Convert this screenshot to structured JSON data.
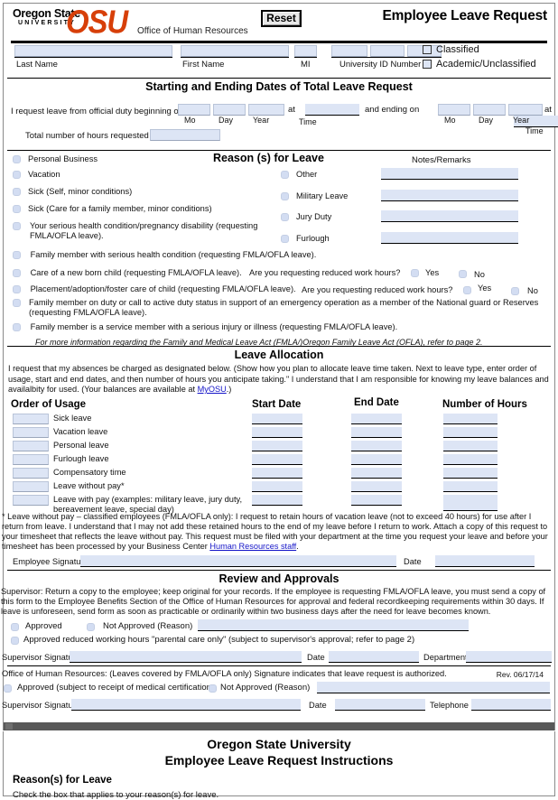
{
  "header": {
    "logo_line1": "Oregon State",
    "logo_line2": "UNIVERSITY",
    "logo_mark": "OSU",
    "office": "Office of Human Resources",
    "reset_label": "Reset",
    "title": "Employee Leave Request",
    "brand_color": "#D73F09"
  },
  "identity": {
    "last_name_label": "Last Name",
    "first_name_label": "First Name",
    "mi_label": "MI",
    "id_label": "University ID Number",
    "last_name_value": "",
    "first_name_value": "",
    "mi_value": "",
    "id_value": "",
    "classified_label": "Classified",
    "academic_label": "Academic/Unclassified"
  },
  "dates": {
    "section_title": "Starting and Ending Dates of Total Leave Request",
    "lead_text": "I request leave from official duty beginning on",
    "at_1": "at",
    "and_ending": "and ending on",
    "at_2": "at",
    "mo_label": "Mo",
    "day_label": "Day",
    "year_label": "Year",
    "time_label": "Time",
    "total_hours_label": "Total number of hours requested",
    "begin_mo": "",
    "begin_day": "",
    "begin_year": "",
    "begin_time": "",
    "end_mo": "",
    "end_day": "",
    "end_year": "",
    "end_time": "",
    "total_hours_value": ""
  },
  "reasons": {
    "section_title": "Reason (s) for Leave",
    "notes_title": "Notes/Remarks",
    "left_items": [
      "Personal Business",
      "Vacation",
      "Sick (Self, minor conditions)",
      "Sick (Care for a family member, minor conditions)",
      "Your serious health condition/pregnancy disability (requesting FMLA/OFLA leave)."
    ],
    "right_items": [
      {
        "label": "Other",
        "note": ""
      },
      {
        "label": "Military Leave",
        "note": ""
      },
      {
        "label": "Jury Duty",
        "note": ""
      },
      {
        "label": "Furlough",
        "note": ""
      }
    ],
    "wide_items": [
      "Family member with serious health condition (requesting FMLA/OFLA leave).",
      "Care of a new born child (requesting FMLA/OFLA leave).",
      "Placement/adoption/foster care of child (requesting FMLA/OFLA leave).",
      "Family member on duty or call to active duty status in support of an emergency operation as a member of the National guard or Reserves (requesting FMLA/OFLA leave).",
      "Family member is a service member with a serious injury or illness (requesting FMLA/OFLA leave)."
    ],
    "reduced_hours_question": "Are you requesting reduced work hours?",
    "yes_label": "Yes",
    "no_label": "No",
    "fmla_note": "For more information regarding the Family and Medical Leave Act (FMLA/)Oregon Family Leave Act (OFLA), refer to page 2."
  },
  "allocation": {
    "section_title": "Leave Allocation",
    "intro": "I request that my absences be charged as designated below.  (Show how you plan to allocate leave time taken.  Next to leave type, enter order of usage, start and end dates, and then number of hours you anticipate taking.\"  I understand that I am responsible for knowing my leave balances and availalbity for used.  (Your balances are available at ",
    "intro_link": "MyOSU",
    "intro_tail": ".)",
    "col_order": "Order of Usage",
    "col_start": "Start Date",
    "col_end": "End Date",
    "col_hours": "Number of Hours",
    "rows": [
      {
        "label": "Sick leave",
        "order": "",
        "start": "",
        "end": "",
        "hours": ""
      },
      {
        "label": "Vacation leave",
        "order": "",
        "start": "",
        "end": "",
        "hours": ""
      },
      {
        "label": "Personal leave",
        "order": "",
        "start": "",
        "end": "",
        "hours": ""
      },
      {
        "label": "Furlough leave",
        "order": "",
        "start": "",
        "end": "",
        "hours": ""
      },
      {
        "label": "Compensatory time",
        "order": "",
        "start": "",
        "end": "",
        "hours": ""
      },
      {
        "label": "Leave without pay*",
        "order": "",
        "start": "",
        "end": "",
        "hours": ""
      },
      {
        "label": "Leave with pay (examples: military leave, jury duty, bereavement leave, special day)",
        "order": "",
        "start": "",
        "end": "",
        "hours": ""
      }
    ],
    "lwp_para_pre": "* Leave without pay – classified employees (FMLA/OFLA only): I request to retain hours of vacation leave (not to exceed 40 hours) for use after I return from leave. I understand that I may not add these retained hours to the end of my leave before I return to work. Attach a copy of this request to your timesheet that reflects the leave without pay. This request must be filed with your department at the time you request your leave and before your timesheet has been processed by your Business Center ",
    "lwp_link": "Human Resources staff",
    "lwp_para_post": ".",
    "employee_signature_label": "Employee Signature",
    "employee_signature_value": "",
    "date_label": "Date",
    "date_value": ""
  },
  "review": {
    "section_title": "Review and Approvals",
    "supervisor_para": "Supervisor: Return a copy to the employee; keep original for your records. If the employee is requesting FMLA/OFLA leave, you must send a copy of this form to the Employee Benefits Section of the Office of Human Resources for approval and federal recordkeeping requirements within 30 days. If leave is unforeseen, send form as soon as practicable or ordinarily within two business days after the need for leave becomes known.",
    "approved_label": "Approved",
    "not_approved_label": "Not Approved (Reason)",
    "not_approved_value": "",
    "reduced_hours_label": "Approved reduced working hours \"parental care only\" (subject to supervisor's approval; refer to page 2)",
    "supervisor_signature_label": "Supervisor Signature",
    "supervisor_signature_value": "",
    "date_label": "Date",
    "date_value": "",
    "department_label": "Department",
    "department_value": ""
  },
  "ohr": {
    "lead": "Office of Human Resources: (Leaves covered by FMLA/OFLA only) Signature indicates that leave request is authorized.",
    "revision": "Rev. 06/17/14",
    "approved_label": "Approved (subject to receipt of medical certification",
    "not_approved_label": "Not Approved (Reason)",
    "not_approved_value": "",
    "supervisor_signature_label": "Supervisor Signature",
    "supervisor_signature_value": "",
    "date_label": "Date",
    "date_value": "",
    "telephone_label": "Telephone",
    "telephone_value": ""
  },
  "instructions": {
    "title_line1": "Oregon State University",
    "title_line2": "Employee Leave Request Instructions",
    "heading": "Reason(s) for Leave",
    "body": "Check the box that applies to your reason(s) for leave."
  }
}
